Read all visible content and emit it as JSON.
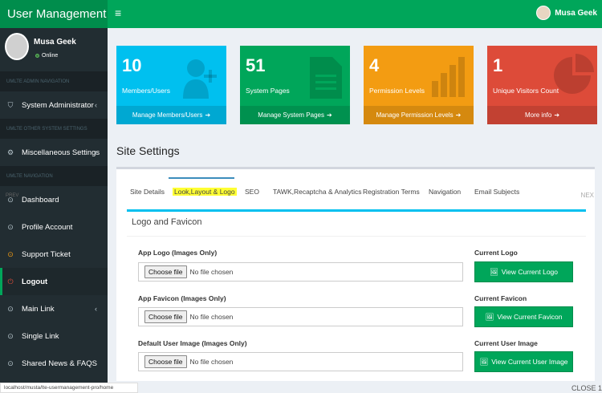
{
  "header": {
    "app_title": "User Management",
    "menu_icon": "≡",
    "user_name": "Musa Geek"
  },
  "sidebar": {
    "user_name": "Musa Geek",
    "user_status": "Online",
    "section_admin": "UMLTE ADMIN NAVIGATION",
    "system_admin": "System Administrator",
    "section_other": "UMLTE OTHER SYSTEM SETTINGS",
    "misc_settings": "Miscellaneous Settings",
    "section_nav": "UMLTE NAVIGATION",
    "prev_tag": "PREV",
    "items": [
      "Dashboard",
      "Profile Account",
      "Support Ticket",
      "Logout",
      "Main Link",
      "Single Link",
      "Shared News & FAQS"
    ]
  },
  "boxes": [
    {
      "number": "10",
      "label": "Members/Users",
      "footer": "Manage Members/Users",
      "color": "#00c0ef"
    },
    {
      "number": "51",
      "label": "System Pages",
      "footer": "Manage System Pages",
      "color": "#00a65a"
    },
    {
      "number": "4",
      "label": "Permission Levels",
      "footer": "Manage Permission Levels",
      "color": "#f39c12"
    },
    {
      "number": "1",
      "label": "Unique Visitors Count",
      "footer": "More info",
      "color": "#dd4b39"
    }
  ],
  "page_title": "Site Settings",
  "tabs": [
    "Site Details",
    "Look,Layout & Logo",
    "SEO",
    "TAWK,Recaptcha & Analytics",
    "Registration Terms",
    "Navigation",
    "Email Subjects"
  ],
  "next_tag": "NEX",
  "section_title": "Logo and Favicon",
  "fields": [
    {
      "label": "App Logo (Images Only)",
      "choose": "Choose file",
      "status": "No file chosen",
      "current_label": "Current Logo",
      "button": "View Current Logo"
    },
    {
      "label": "App Favicon (Images Only)",
      "choose": "Choose file",
      "status": "No file chosen",
      "current_label": "Current Favicon",
      "button": "View Current Favicon"
    },
    {
      "label": "Default User Image (Images Only)",
      "choose": "Choose file",
      "status": "No file chosen",
      "current_label": "Current User Image",
      "button": "View Current User Image"
    }
  ],
  "status_url": "localhost/musta/lte-usermanagement-pro/home",
  "close_tag": "CLOSE 1"
}
